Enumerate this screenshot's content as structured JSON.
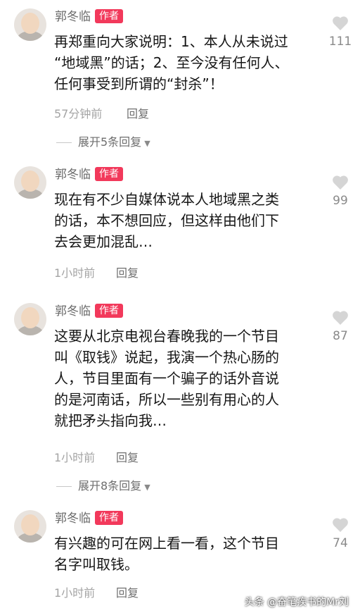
{
  "author_badge": "作者",
  "reply_label": "回复",
  "comments": [
    {
      "name": "郭冬临",
      "lines": [
        "再郑重向大家说明：1、本人从未说过",
        "“地域黑”的话；2、至今没有任何人、",
        "任何事受到所谓的“封杀”！"
      ],
      "time": "57分钟前",
      "likes": "111",
      "expand": "展开5条回复"
    },
    {
      "name": "郭冬临",
      "lines": [
        "现在有不少自媒体说本人地域黑之类",
        "的话，本不想回应，但这样由他们下",
        "去会更加混乱…"
      ],
      "time": "1小时前",
      "likes": "99"
    },
    {
      "name": "郭冬临",
      "lines": [
        "这要从北京电视台春晚我的一个节目",
        "叫《取钱》说起，我演一个热心肠的",
        "人，节目里面有一个骗子的话外音说",
        "的是河南话，所以一些别有用心的人",
        "就把矛头指向我…"
      ],
      "time": "1小时前",
      "likes": "87",
      "expand": "展开8条回复"
    },
    {
      "name": "郭冬临",
      "lines": [
        "有兴趣的可在网上看一看，这个节目",
        "名字叫取钱。"
      ],
      "time": "1小时前",
      "likes": "74"
    }
  ],
  "watermark": "头条 @奋笔疾书的Mr刘",
  "colors": {
    "badge": "#f2395b",
    "heart": "#d5d5d5",
    "meta": "#a4a4a4"
  }
}
